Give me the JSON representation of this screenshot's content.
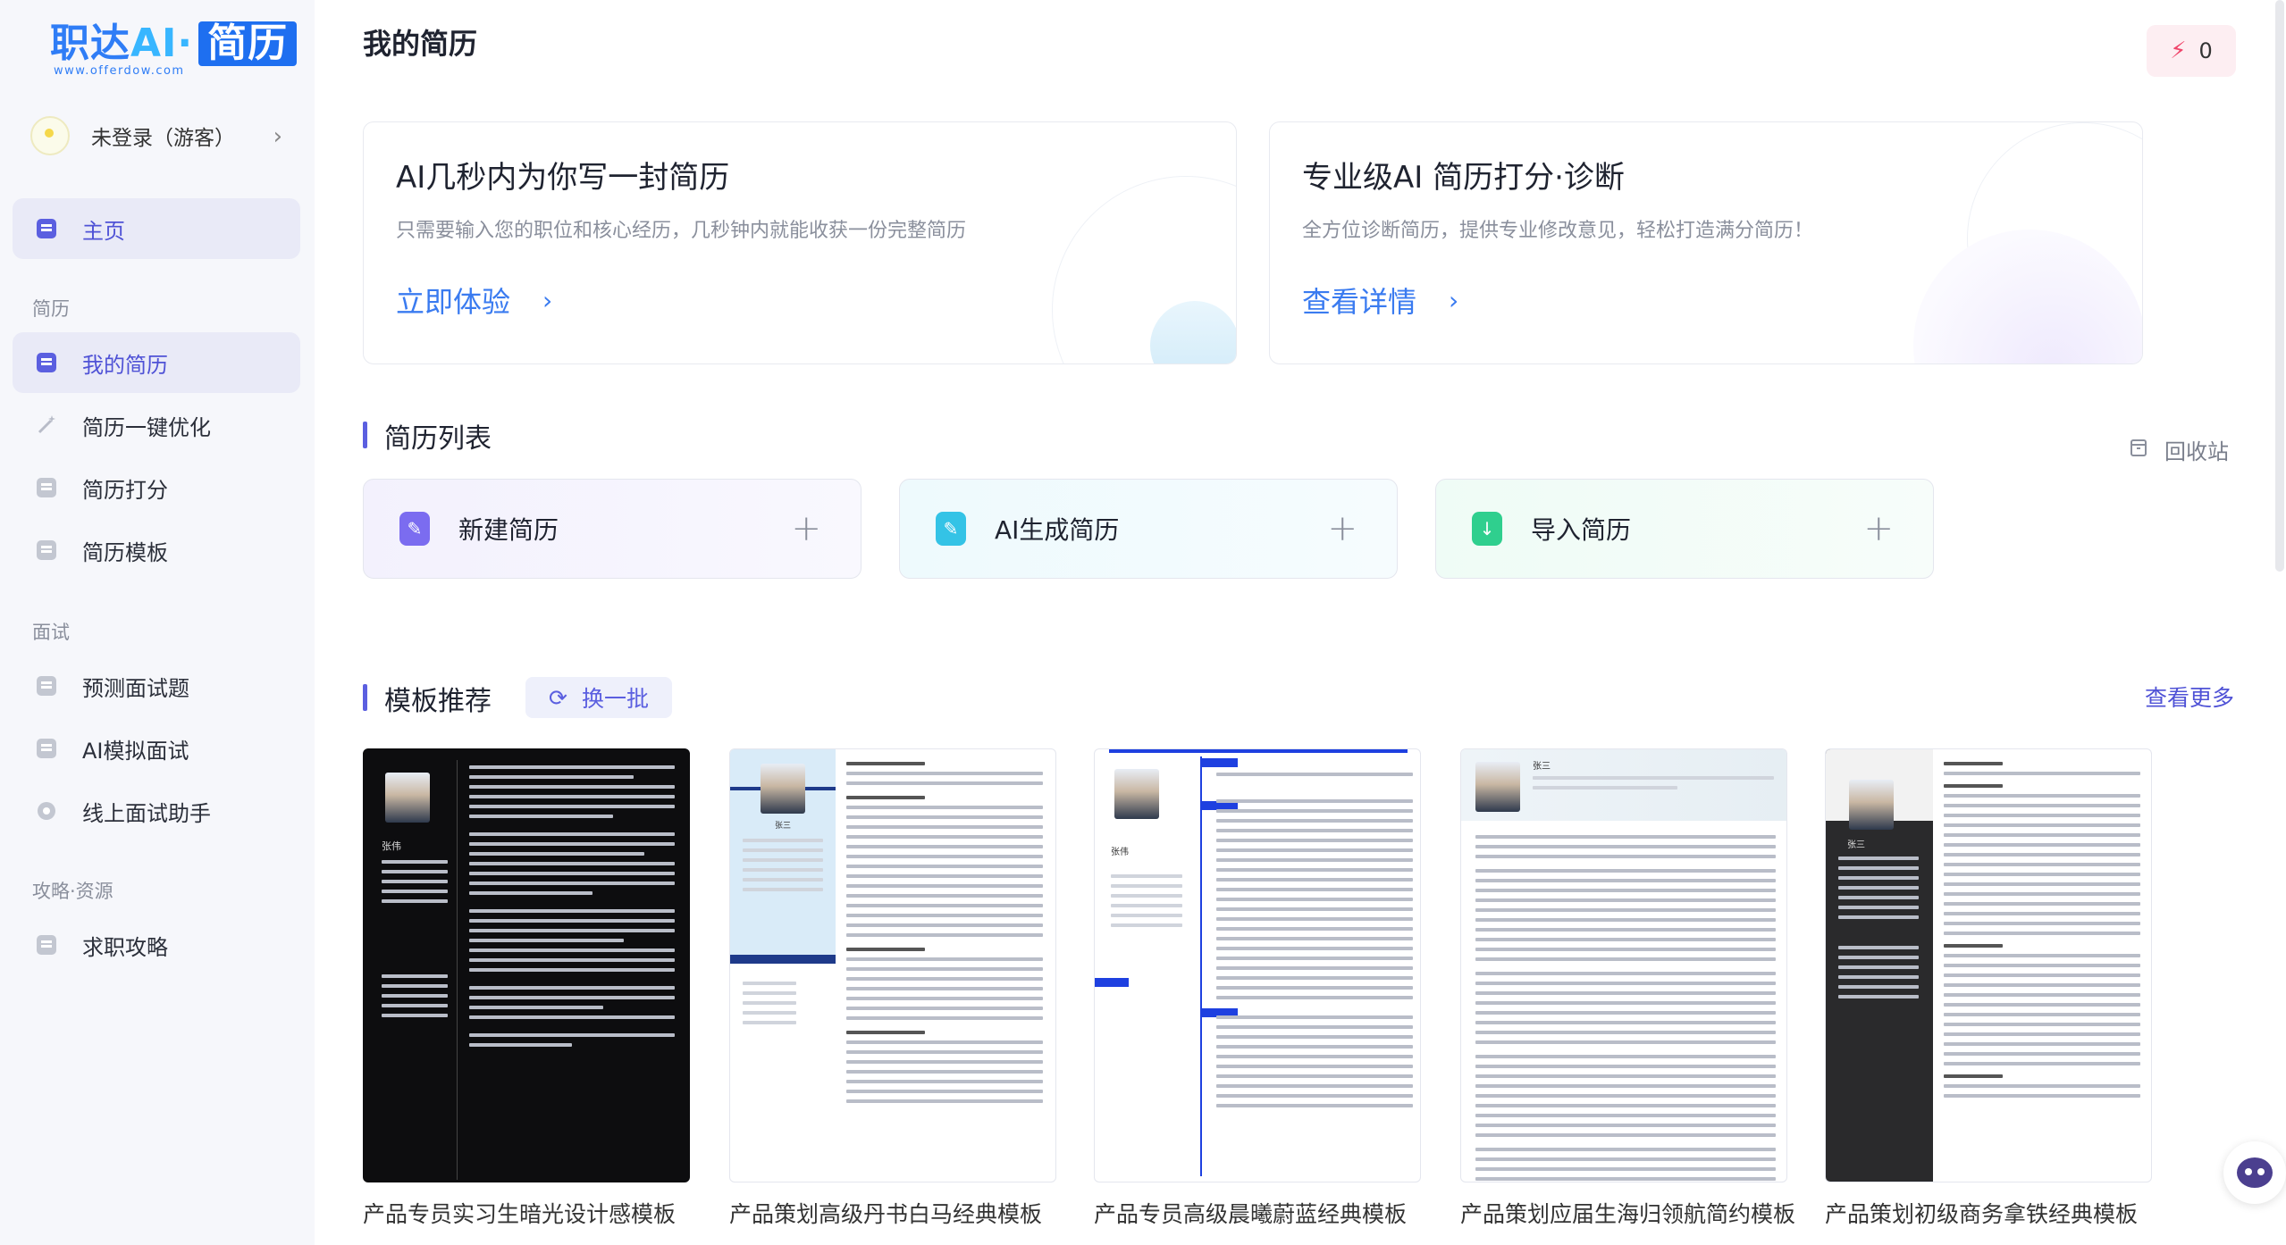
{
  "brand": {
    "logo_text_a": "职达",
    "logo_text_ai": "AI·",
    "logo_text_b": "简历",
    "logo_url": "www.offerdow.com"
  },
  "user": {
    "name": "未登录（游客）"
  },
  "sidebar": {
    "home": "主页",
    "section_resume": "简历",
    "items_resume": [
      "我的简历",
      "简历一键优化",
      "简历打分",
      "简历模板"
    ],
    "section_interview": "面试",
    "items_interview": [
      "预测面试题",
      "AI模拟面试",
      "线上面试助手"
    ],
    "section_guide": "攻略·资源",
    "items_guide": [
      "求职攻略"
    ]
  },
  "header": {
    "title": "我的简历",
    "credits": "0"
  },
  "promos": [
    {
      "title": "AI几秒内为你写一封简历",
      "desc": "只需要输入您的职位和核心经历，几秒钟内就能收获一份完整简历",
      "cta": "立即体验"
    },
    {
      "title": "专业级AI 简历打分·诊断",
      "desc": "全方位诊断简历，提供专业修改意见，轻松打造满分简历！",
      "cta": "查看详情"
    }
  ],
  "resume_list": {
    "title": "简历列表",
    "recycle": "回收站",
    "actions": [
      {
        "label": "新建简历",
        "color": "#7b6cf0"
      },
      {
        "label": "AI生成简历",
        "color": "#34c3e6"
      },
      {
        "label": "导入简历",
        "color": "#2fcf8e"
      }
    ]
  },
  "templates": {
    "title": "模板推荐",
    "swap": "换一批",
    "more": "查看更多",
    "items": [
      {
        "caption": "产品专员实习生暗光设计感模板",
        "name": "张伟"
      },
      {
        "caption": "产品策划高级丹书白马经典模板",
        "name": "张三"
      },
      {
        "caption": "产品专员高级晨曦蔚蓝经典模板",
        "name": "张伟"
      },
      {
        "caption": "产品策划应届生海归领航简约模板",
        "name": "张三"
      },
      {
        "caption": "产品策划初级商务拿铁经典模板",
        "name": "张三"
      }
    ]
  },
  "icons": {
    "home": "home-icon",
    "resume": "document-icon",
    "optimize": "magic-wand-icon",
    "score": "score-icon",
    "template": "template-icon",
    "predict": "question-icon",
    "mock": "chat-icon",
    "assistant": "assistant-icon",
    "guide": "book-icon",
    "recycle": "trash-icon",
    "refresh": "refresh-icon",
    "plus": "plus-icon",
    "chevron": "chevron-right-icon",
    "bolt": "lightning-icon",
    "bot": "chatbot-icon"
  }
}
